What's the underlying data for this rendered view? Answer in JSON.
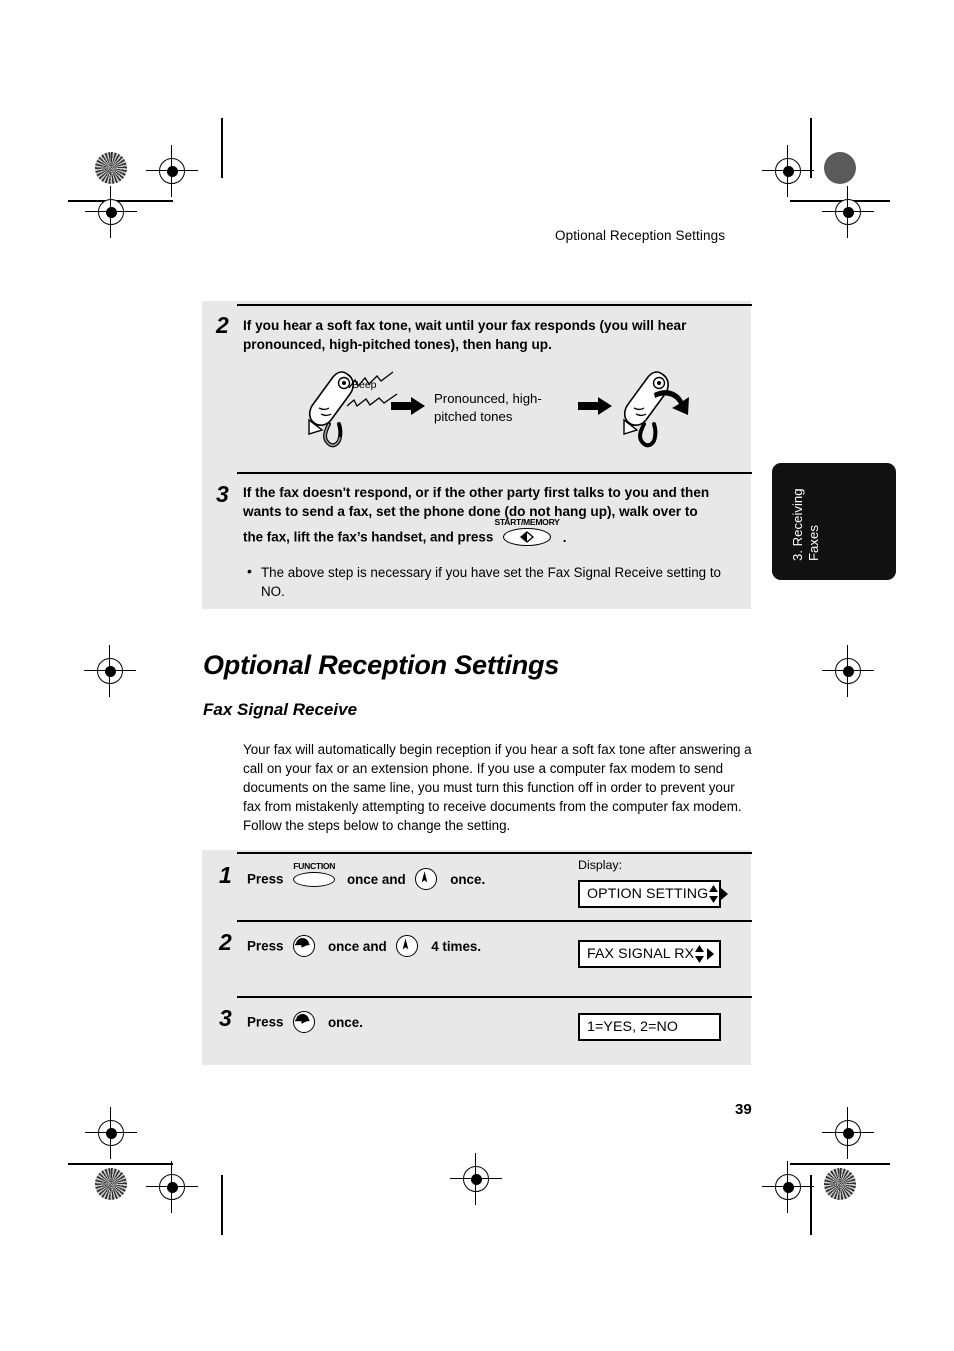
{
  "page": {
    "running_head": "Optional Reception Settings",
    "page_number": "39"
  },
  "side_tab": {
    "line1": "3. Receiving",
    "line2": "Faxes"
  },
  "panel_top": {
    "steps": [
      {
        "number": "2",
        "text": "If you hear a soft fax tone, wait until your fax responds (you will hear pronounced, high-pitched tones), then hang up.",
        "illustration": {
          "beep_label": "Beep",
          "caption": "Pronounced, high-pitched tones",
          "handset_icon_left": "telephone-handset-icon",
          "handset_icon_right": "telephone-handset-hangup-icon",
          "arrow_icon": "right-arrow-icon"
        }
      },
      {
        "number": "3",
        "text_part1": "If the fax doesn't respond, or if the other party first talks to you and then wants to send a fax, set the phone done (do not hang up), walk over to",
        "text_part2": "the fax, lift the fax’s handset, and press",
        "text_part3": ".",
        "button_label": "START/MEMORY",
        "bullet": "The above step is necessary if you have set the Fax Signal Receive setting to NO."
      }
    ]
  },
  "section": {
    "heading": "Optional Reception Settings",
    "subheading": "Fax Signal Receive",
    "paragraph": "Your fax will automatically begin reception if you hear a soft fax tone after answering a call on your fax or an extension phone. If you use a computer fax modem to send documents on the same line, you must turn this function off in order to prevent your fax from mistakenly attempting to receive documents from the computer fax modem. Follow the steps below to change the setting."
  },
  "procedure": {
    "display_label": "Display:",
    "steps": [
      {
        "number": "1",
        "press_word": "Press",
        "button1_caption": "FUNCTION",
        "mid_text": "once and",
        "button2_icon": "down-arrow-circle-icon",
        "end_text": "once.",
        "display_text": "OPTION SETTING",
        "display_arrows": "updown-right-arrows"
      },
      {
        "number": "2",
        "press_word": "Press",
        "button1_icon": "right-arrow-circle-icon",
        "mid_text": "once and",
        "button2_icon": "down-arrow-circle-icon",
        "end_text": "4 times.",
        "display_text": "FAX SIGNAL RX",
        "display_arrows": "updown-right-arrows"
      },
      {
        "number": "3",
        "press_word": "Press",
        "button1_icon": "right-arrow-circle-icon",
        "end_text": "once.",
        "display_text": "1=YES, 2=NO",
        "display_arrows": ""
      }
    ]
  },
  "colors": {
    "panel_bg": "#e8e8e8",
    "tab_bg": "#111111",
    "ink": "#000000"
  }
}
